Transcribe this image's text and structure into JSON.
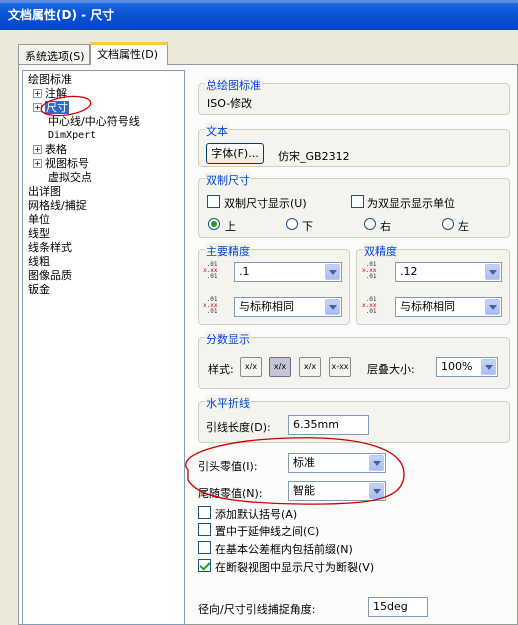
{
  "window": {
    "title": "文档属性(D) - 尺寸"
  },
  "tabs": [
    {
      "label": "系统选项(S)",
      "active": false
    },
    {
      "label": "文档属性(D)",
      "active": true
    }
  ],
  "tree": {
    "items": [
      {
        "label": "绘图标准",
        "level": 0,
        "expander": ""
      },
      {
        "label": "注解",
        "level": 1,
        "expander": "+"
      },
      {
        "label": "尺寸",
        "level": 1,
        "expander": "+",
        "selected": true
      },
      {
        "label": "中心线/中心符号线",
        "level": 2,
        "expander": ""
      },
      {
        "label": "DimXpert",
        "level": 2,
        "expander": ""
      },
      {
        "label": "表格",
        "level": 1,
        "expander": "+"
      },
      {
        "label": "视图标号",
        "level": 1,
        "expander": "+"
      },
      {
        "label": "虚拟交点",
        "level": 2,
        "expander": ""
      },
      {
        "label": "出详图",
        "level": 0,
        "expander": ""
      },
      {
        "label": "网格线/捕捉",
        "level": 0,
        "expander": ""
      },
      {
        "label": "单位",
        "level": 0,
        "expander": ""
      },
      {
        "label": "线型",
        "level": 0,
        "expander": ""
      },
      {
        "label": "线条样式",
        "level": 0,
        "expander": ""
      },
      {
        "label": "线粗",
        "level": 0,
        "expander": ""
      },
      {
        "label": "图像品质",
        "level": 0,
        "expander": ""
      },
      {
        "label": "钣金",
        "level": 0,
        "expander": ""
      }
    ]
  },
  "overall_standard": {
    "label": "总绘图标准",
    "value": "ISO-修改"
  },
  "text": {
    "label": "文本",
    "font_button": "字体(F)...",
    "font_name": "仿宋_GB2312"
  },
  "dual": {
    "label": "双制尺寸",
    "show_label": "双制尺寸显示(U)",
    "show_checked": false,
    "units_label": "为双显示显示单位",
    "units_checked": false,
    "positions": [
      {
        "label": "上",
        "selected": true
      },
      {
        "label": "下",
        "selected": false
      },
      {
        "label": "右",
        "selected": false
      },
      {
        "label": "左",
        "selected": false
      }
    ]
  },
  "primary_precision": {
    "label": "主要精度",
    "value1": ".1",
    "value2": "与标称相同"
  },
  "dual_precision": {
    "label": "双精度",
    "value1": ".12",
    "value2": "与标称相同"
  },
  "fraction": {
    "label": "分数显示",
    "style_label": "样式:",
    "stack_label": "层叠大小:",
    "stack_value": "100%",
    "buttons": [
      {
        "symbol": "x/x",
        "active": false
      },
      {
        "symbol": "x/x",
        "active": true
      },
      {
        "symbol": "x/x",
        "active": false
      },
      {
        "symbol": "x-xx",
        "active": false
      }
    ]
  },
  "horizontal_break": {
    "label": "水平折线",
    "length_label": "引线长度(D):",
    "length_value": "6.35mm"
  },
  "zeros": {
    "leading_label": "引头零值(I):",
    "leading_value": "标准",
    "trailing_label": "尾随零值(N):",
    "trailing_value": "智能"
  },
  "options": [
    {
      "label": "添加默认括号(A)",
      "checked": false
    },
    {
      "label": "置中于延伸线之间(C)",
      "checked": false
    },
    {
      "label": "在基本公差框内包括前缀(N)",
      "checked": false
    },
    {
      "label": "在断裂视图中显示尺寸为断裂(V)",
      "checked": true
    }
  ],
  "snap_angle": {
    "label": "径向/尺寸引线捕捉角度:",
    "value": "15deg"
  },
  "colors": {
    "annotation": "#cc0000",
    "group_title": "#0046d5",
    "selection": "#316ac5"
  }
}
